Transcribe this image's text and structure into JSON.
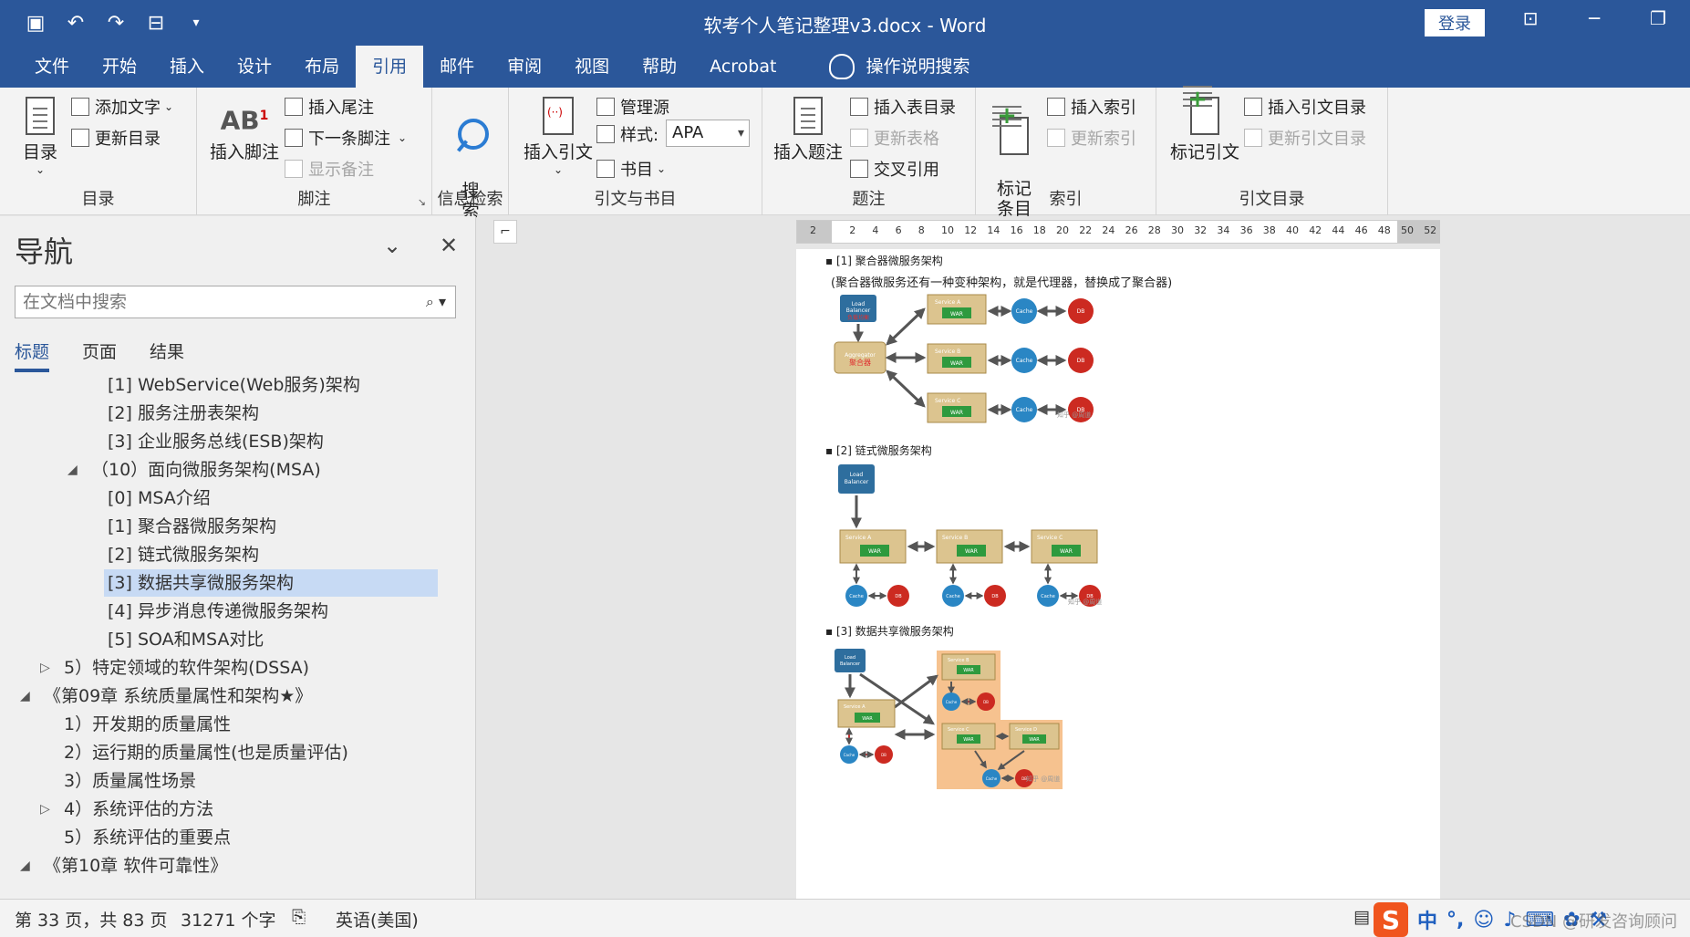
{
  "window": {
    "title": "软考个人笔记整理v3.docx  -  Word",
    "login_label": "登录"
  },
  "menu": {
    "tabs": [
      "文件",
      "开始",
      "插入",
      "设计",
      "布局",
      "引用",
      "邮件",
      "审阅",
      "视图",
      "帮助",
      "Acrobat"
    ],
    "active_tab": "引用",
    "tell_me": "操作说明搜索"
  },
  "ribbon": {
    "toc": {
      "group": "目录",
      "toc_button": "目录",
      "add_text": "添加文字",
      "update_toc": "更新目录"
    },
    "footnotes": {
      "group": "脚注",
      "insert_footnote": "插入脚注",
      "insert_endnote": "插入尾注",
      "next_footnote": "下一条脚注",
      "show_notes": "显示备注"
    },
    "research": {
      "group": "信息检索",
      "search_button": "搜\n索"
    },
    "citations": {
      "group": "引文与书目",
      "insert_citation": "插入引文",
      "manage_sources": "管理源",
      "style_label": "样式:",
      "style_value": "APA",
      "bibliography": "书目"
    },
    "captions": {
      "group": "题注",
      "insert_caption": "插入题注",
      "insert_table_figures": "插入表目录",
      "update_table": "更新表格",
      "cross_reference": "交叉引用"
    },
    "index": {
      "group": "索引",
      "mark_entry": "标记\n条目",
      "insert_index": "插入索引",
      "update_index": "更新索引"
    },
    "toa": {
      "group": "引文目录",
      "mark_citation": "标记引文",
      "insert_toa": "插入引文目录",
      "update_toa": "更新引文目录"
    }
  },
  "navigation": {
    "title": "导航",
    "search_placeholder": "在文档中搜索",
    "tabs": [
      "标题",
      "页面",
      "结果"
    ],
    "active_tab": "标题",
    "tree": [
      {
        "text": "[1] WebService(Web服务)架构",
        "level": 3
      },
      {
        "text": "[2] 服务注册表架构",
        "level": 3
      },
      {
        "text": "[3] 企业服务总线(ESB)架构",
        "level": 3
      },
      {
        "text": "（10）面向微服务架构(MSA)",
        "level": 2,
        "twisty": "expanded"
      },
      {
        "text": "[0] MSA介绍",
        "level": 3
      },
      {
        "text": "[1] 聚合器微服务架构",
        "level": 3
      },
      {
        "text": "[2] 链式微服务架构",
        "level": 3
      },
      {
        "text": "[3] 数据共享微服务架构",
        "level": 3,
        "selected": true
      },
      {
        "text": "[4] 异步消息传递微服务架构",
        "level": 3
      },
      {
        "text": "[5] SOA和MSA对比",
        "level": 3
      },
      {
        "text": "5）特定领域的软件架构(DSSA)",
        "level": 1,
        "twisty": "collapsed"
      },
      {
        "text": "《第09章 系统质量属性和架构★》",
        "level": 0,
        "twisty": "expanded"
      },
      {
        "text": "1）开发期的质量属性",
        "level": 1
      },
      {
        "text": "2）运行期的质量属性(也是质量评估)",
        "level": 1
      },
      {
        "text": "3）质量属性场景",
        "level": 1
      },
      {
        "text": "4）系统评估的方法",
        "level": 1,
        "twisty": "collapsed"
      },
      {
        "text": "5）系统评估的重要点",
        "level": 1
      },
      {
        "text": "《第10章 软件可靠性》",
        "level": 0,
        "twisty": "expanded"
      }
    ]
  },
  "ruler": {
    "numbers": [
      "2",
      "2",
      "4",
      "6",
      "8",
      "10",
      "12",
      "14",
      "16",
      "18",
      "20",
      "22",
      "24",
      "26",
      "28",
      "30",
      "32",
      "34",
      "36",
      "38",
      "40",
      "42",
      "44",
      "46",
      "48",
      "50",
      "52"
    ]
  },
  "document": {
    "section1_heading": "[1] 聚合器微服务架构",
    "section1_para": "(聚合器微服务还有一种变种架构，就是代理器，替换成了聚合器)",
    "section2_heading": "[2] 链式微服务架构",
    "section3_heading": "[3] 数据共享微服务架构",
    "labels": {
      "lb": "Load\nBalancer",
      "proxy_cn": "负载均衡",
      "aggregator": "Aggregator",
      "aggregator_cn": "聚合器",
      "service_a": "Service A",
      "service_b": "Service B",
      "service_c": "Service C",
      "service_d": "Service D",
      "war": "WAR",
      "cache": "Cache",
      "db": "DB",
      "img_watermark": "知乎 @周道"
    },
    "colors": {
      "lb": "#2e6e9e",
      "service": "#dcc48f",
      "war": "#2e9a3e",
      "cache": "#2a86c4",
      "db": "#cc2a21",
      "highlight": "#f6c28f"
    }
  },
  "status": {
    "page": "第 33 页，共 83 页",
    "words": "31271 个字",
    "language": "英语(美国)",
    "ime_cn": "中",
    "watermark": "CSDN @研发咨询顾问"
  }
}
